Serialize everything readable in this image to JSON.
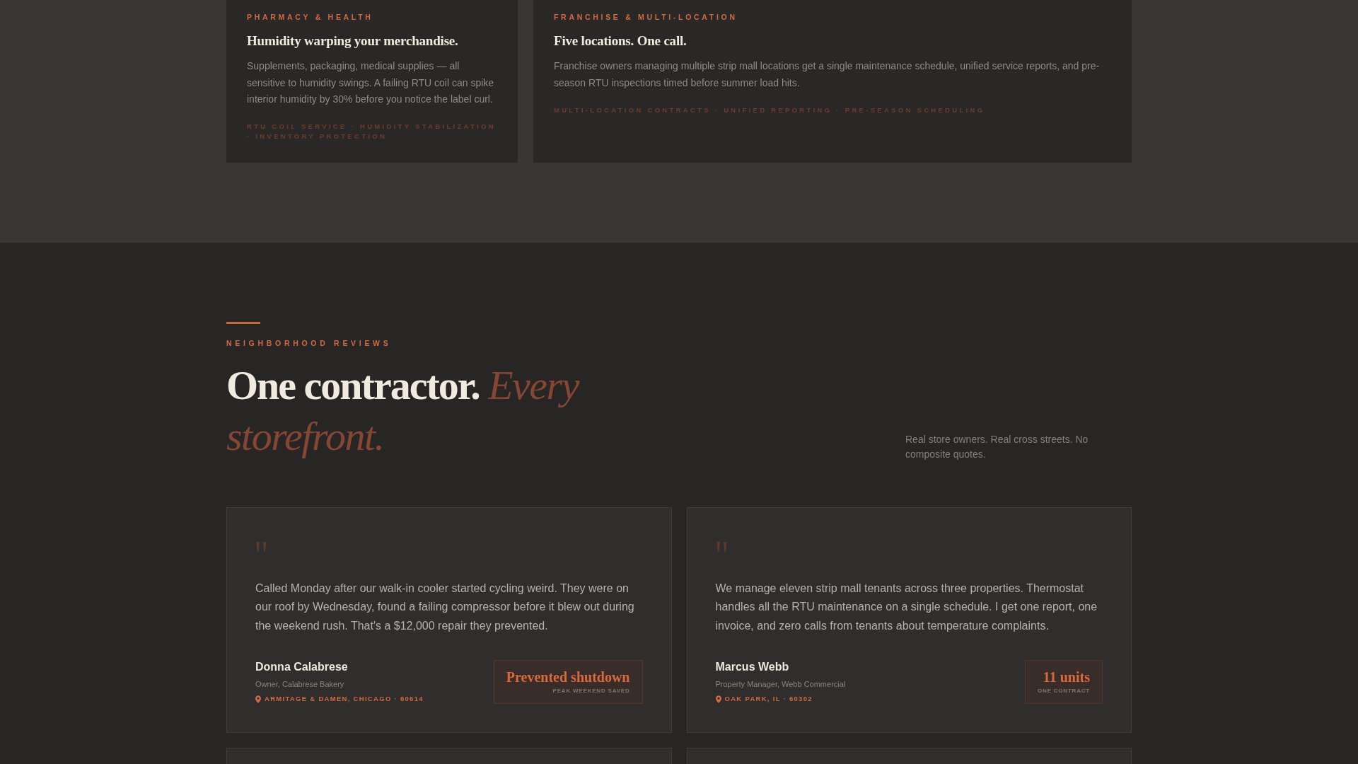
{
  "services": {
    "cards": [
      {
        "category": "PHARMACY & HEALTH",
        "title": "Humidity warping your merchandise.",
        "description": "Supplements, packaging, medical supplies — all sensitive to humidity swings. A failing RTU coil can spike interior humidity by 30% before you notice the label curl.",
        "tags": "RTU COIL SERVICE · HUMIDITY STABILIZATION · INVENTORY PROTECTION"
      },
      {
        "category": "FRANCHISE & MULTI-LOCATION",
        "title": "Five locations. One call.",
        "description": "Franchise owners managing multiple strip mall locations get a single maintenance schedule, unified service reports, and pre-season RTU inspections timed before summer load hits.",
        "tags": "MULTI-LOCATION CONTRACTS · UNIFIED REPORTING · PRE-SEASON SCHEDULING"
      }
    ]
  },
  "reviews": {
    "eyebrow": "NEIGHBORHOOD REVIEWS",
    "heading": "One contractor. *Every storefront.*",
    "intro": "Real store owners. Real cross streets. No composite quotes.",
    "cards": [
      {
        "kind": "review",
        "quote": "Called Monday after our walk-in cooler started cycling weird. They were on our roof by Wednesday, found a failing compressor before it blew out during the weekend rush. That's a $12,000 repair they prevented.",
        "name": "Donna Calabrese",
        "role": "Owner, Calabrese Bakery",
        "location": "ARMITAGE & DAMEN, CHICAGO · 60614",
        "stat": {
          "value": "Prevented shutdown",
          "caption": "PEAK WEEKEND SAVED"
        }
      },
      {
        "kind": "review",
        "quote": "We manage eleven strip mall tenants across three properties. Thermostat handles all the RTU maintenance on a single schedule. I get one report, one invoice, and zero calls from tenants about temperature complaints.",
        "name": "Marcus Webb",
        "role": "Property Manager, Webb Commercial",
        "location": "OAK PARK, IL · 60302",
        "stat": {
          "value": "11 units",
          "caption": "ONE CONTRACT"
        }
      },
      {
        "kind": "clipped"
      },
      {
        "kind": "clipped"
      }
    ]
  }
}
